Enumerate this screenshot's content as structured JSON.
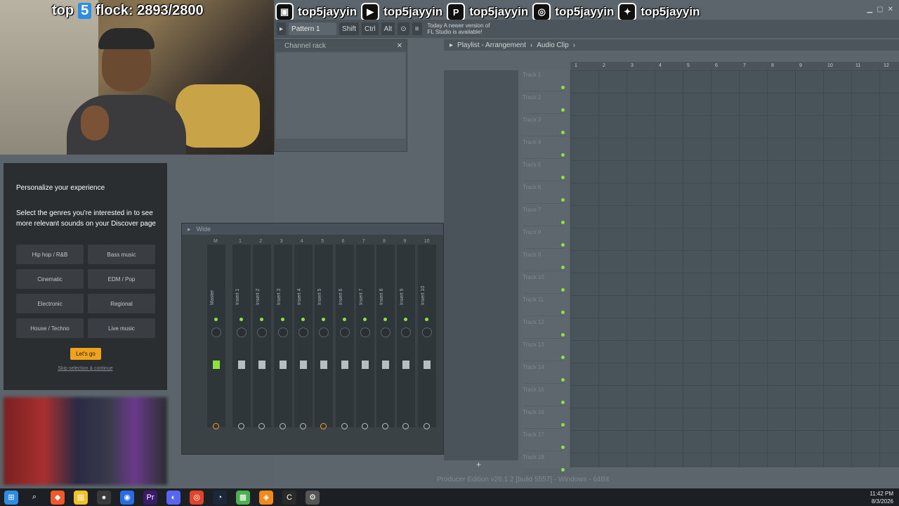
{
  "overlay": {
    "title_pre": "top",
    "title_badge": "5",
    "title_post": "flock: 2893/2800"
  },
  "social": [
    {
      "icon": "twitch-icon",
      "glyph": "▣",
      "handle": "top5jayyin"
    },
    {
      "icon": "youtube-icon",
      "glyph": "▶",
      "handle": "top5jayyin"
    },
    {
      "icon": "patreon-icon",
      "glyph": "P",
      "handle": "top5jayyin"
    },
    {
      "icon": "instagram-icon",
      "glyph": "◎",
      "handle": "top5jayyin"
    },
    {
      "icon": "twitter-icon",
      "glyph": "✦",
      "handle": "top5jayyin"
    }
  ],
  "fl": {
    "pattern": "Pattern 1",
    "shift": "Shift",
    "ctrl": "Ctrl",
    "alt": "Alt",
    "news_line1": "Today  A newer version of",
    "news_line2": "FL Studio is available!",
    "channel_rack": "Channel rack",
    "playlist_title": "Playlist - Arrangement",
    "playlist_sub": "Audio Clip",
    "mixer_mode": "Wide",
    "footer": "Producer Edition v26.1.2 [build 5557] - Windows - 64Bit",
    "add_track": "+"
  },
  "personalize": {
    "heading": "Personalize your experience",
    "body": "Select the genres you're interested in to see more relevant sounds on your Discover page",
    "genres": [
      "Hip hop / R&B",
      "Bass music",
      "Cinematic",
      "EDM / Pop",
      "Electronic",
      "Regional",
      "House / Techno",
      "Live music"
    ],
    "cta": "Let's go",
    "skip": "Skip selection & continue"
  },
  "mixer": {
    "strips": [
      {
        "label": "Master",
        "num": "M"
      },
      {
        "label": "Insert 1",
        "num": "1"
      },
      {
        "label": "Insert 2",
        "num": "2"
      },
      {
        "label": "Insert 3",
        "num": "3"
      },
      {
        "label": "Insert 4",
        "num": "4"
      },
      {
        "label": "Insert 5",
        "num": "5"
      },
      {
        "label": "Insert 6",
        "num": "6"
      },
      {
        "label": "Insert 7",
        "num": "7"
      },
      {
        "label": "Insert 8",
        "num": "8"
      },
      {
        "label": "Insert 9",
        "num": "9"
      },
      {
        "label": "Insert 10",
        "num": "10"
      }
    ]
  },
  "playlist": {
    "tracks": [
      "Track 1",
      "Track 2",
      "Track 3",
      "Track 4",
      "Track 5",
      "Track 6",
      "Track 7",
      "Track 8",
      "Track 9",
      "Track 10",
      "Track 11",
      "Track 12",
      "Track 13",
      "Track 14",
      "Track 15",
      "Track 16",
      "Track 17",
      "Track 18"
    ],
    "bars": [
      "1",
      "2",
      "3",
      "4",
      "5",
      "6",
      "7",
      "8",
      "9",
      "10",
      "11",
      "12"
    ]
  },
  "taskbar": {
    "apps": [
      "windows-start-icon",
      "search-icon",
      "brave-icon",
      "file-explorer-icon",
      "obs-icon",
      "chrome-canary-icon",
      "premiere-icon",
      "discord-icon",
      "chrome-icon",
      "steam-icon",
      "minecraft-icon",
      "fl-studio-icon",
      "capcut-icon",
      "settings-icon"
    ],
    "time": "11:42 PM",
    "date": "8/3/2026"
  }
}
